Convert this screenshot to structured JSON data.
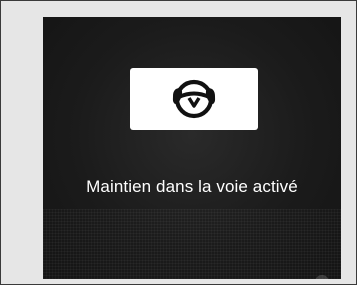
{
  "screen": {
    "icon": "steering-wheel-hands-on-icon",
    "message": "Maintien dans la voie activé"
  },
  "colors": {
    "screen_background": "#1b1b1b",
    "icon_box": "#ffffff",
    "icon_stroke": "#111111",
    "text": "#ffffff",
    "frame_background": "#e6e6e6"
  }
}
